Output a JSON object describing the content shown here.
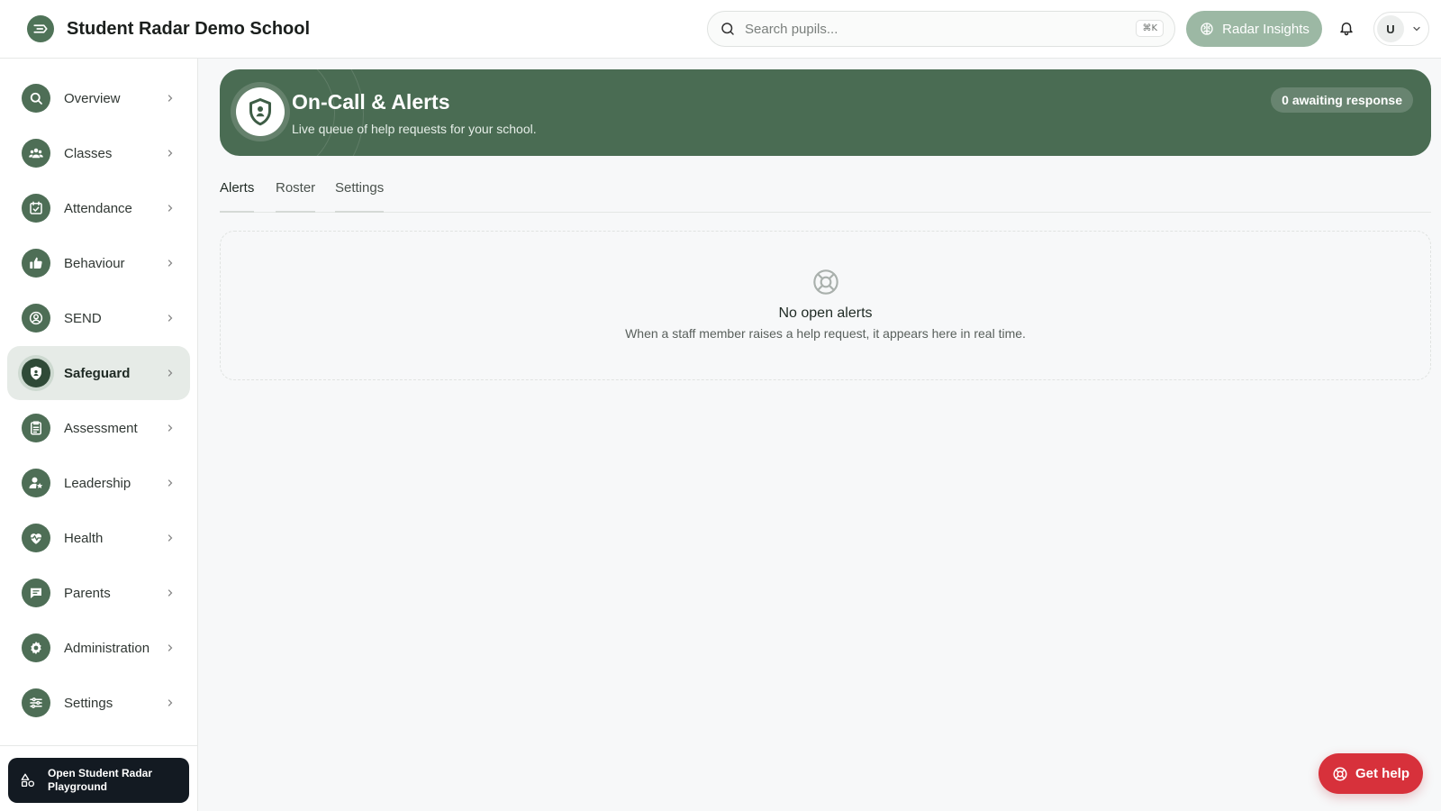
{
  "header": {
    "school_name": "Student Radar Demo School",
    "search_placeholder": "Search pupils...",
    "search_shortcut": "⌘K",
    "insights_label": "Radar Insights",
    "user_initial": "U"
  },
  "sidebar": {
    "items": [
      {
        "label": "Overview",
        "icon": "search-icon"
      },
      {
        "label": "Classes",
        "icon": "users-icon"
      },
      {
        "label": "Attendance",
        "icon": "calendar-check-icon"
      },
      {
        "label": "Behaviour",
        "icon": "thumbs-up-icon"
      },
      {
        "label": "SEND",
        "icon": "user-circle-icon"
      },
      {
        "label": "Safeguard",
        "icon": "shield-icon",
        "active": true
      },
      {
        "label": "Assessment",
        "icon": "clipboard-list-icon"
      },
      {
        "label": "Leadership",
        "icon": "user-star-icon"
      },
      {
        "label": "Health",
        "icon": "heart-pulse-icon"
      },
      {
        "label": "Parents",
        "icon": "message-icon"
      },
      {
        "label": "Administration",
        "icon": "gear-icon"
      },
      {
        "label": "Settings",
        "icon": "sliders-icon"
      }
    ],
    "playground_label": "Open Student Radar Playground"
  },
  "banner": {
    "title": "On-Call & Alerts",
    "subtitle": "Live queue of help requests for your school.",
    "badge": "0 awaiting response"
  },
  "tabs": [
    {
      "label": "Alerts",
      "active": true
    },
    {
      "label": "Roster",
      "active": false
    },
    {
      "label": "Settings",
      "active": false
    }
  ],
  "empty_state": {
    "title": "No open alerts",
    "message": "When a staff member raises a help request, it appears here in real time."
  },
  "help_button": {
    "label": "Get help"
  },
  "colors": {
    "brand_green": "#4a6c53",
    "nav_icon_green": "#4e6e56",
    "help_red": "#d7313b",
    "playground_dark": "#131a22"
  }
}
